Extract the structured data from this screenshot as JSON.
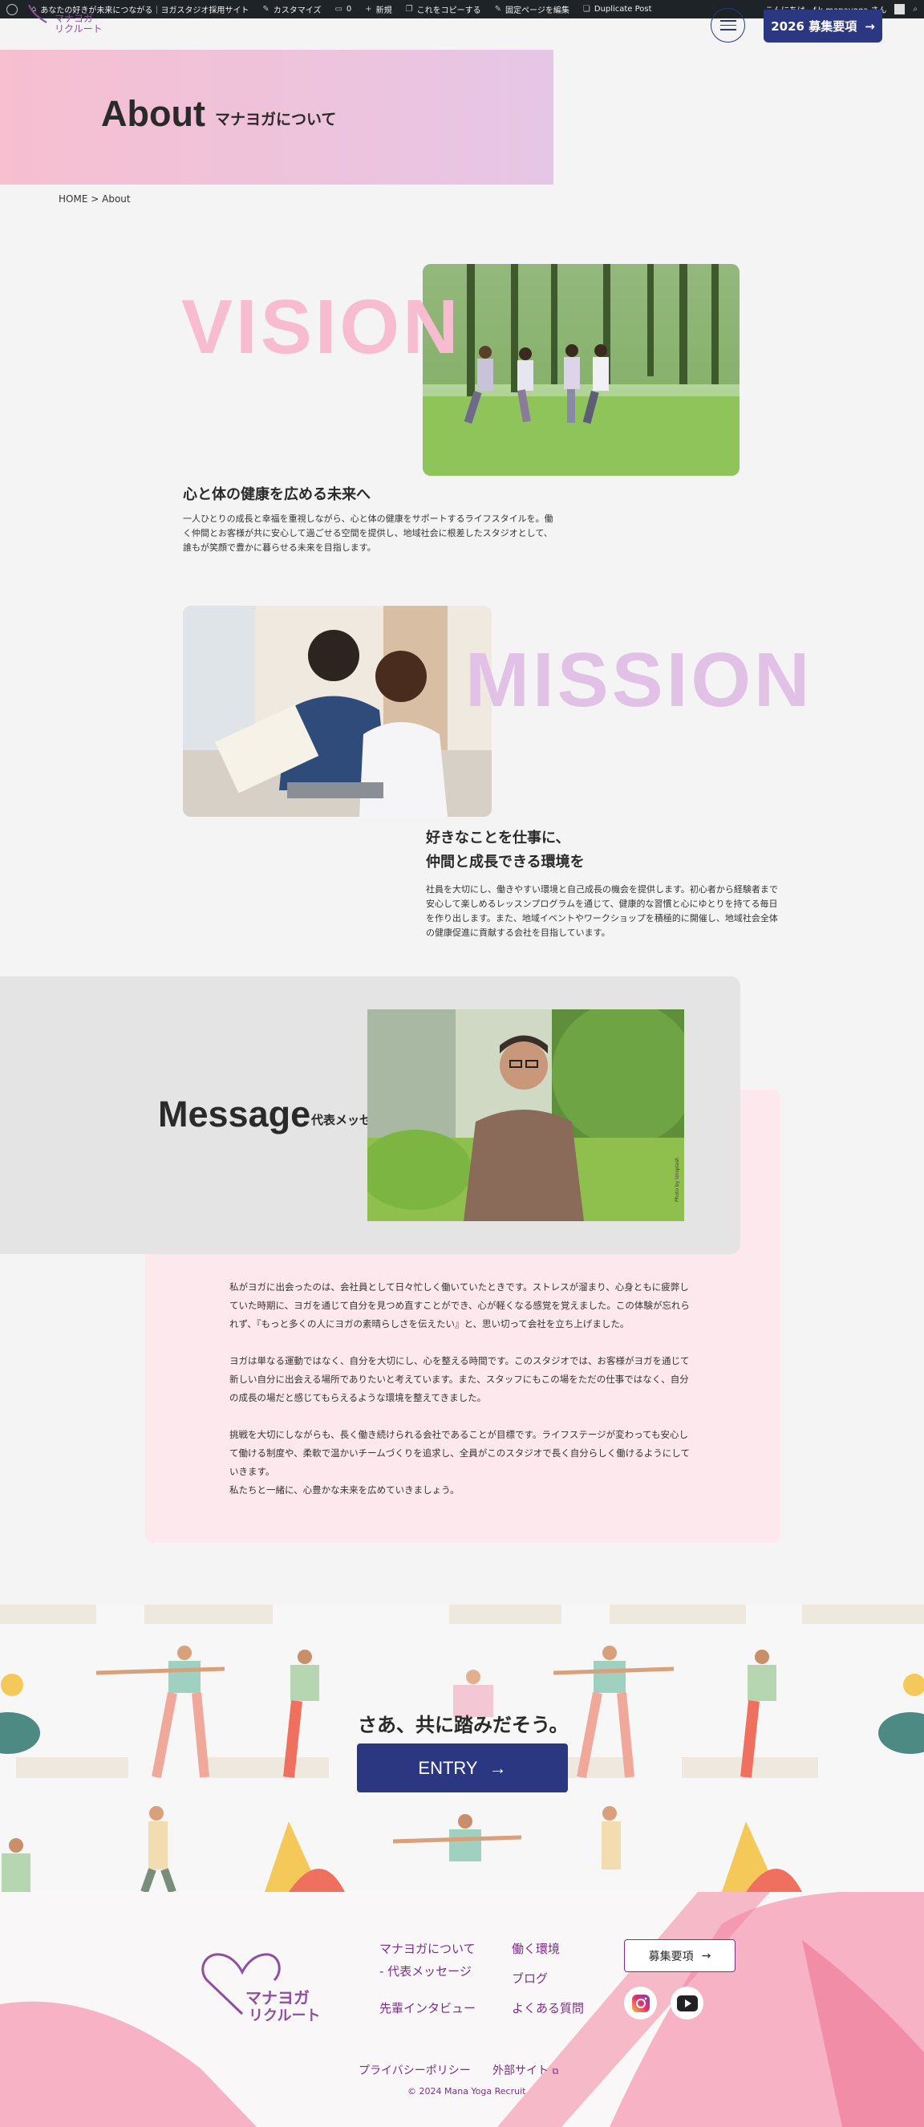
{
  "admin_bar": {
    "site_name": "あなたの好きが未来につながる｜ヨガスタジオ採用サイト",
    "customize": "カスタマイズ",
    "comments_count": "0",
    "new": "新規",
    "copy": "これをコピーする",
    "edit_fixed": "固定ページを編集",
    "duplicate": "Duplicate Post",
    "greeting": "こんにちは、f.k-manayoga さん"
  },
  "header": {
    "logo_line1": "マナヨガ",
    "logo_line2": "リクルート",
    "recruit_button": "2026 募集要項",
    "arrow": "→"
  },
  "hero": {
    "title": "About",
    "subtitle": "マナヨガについて"
  },
  "breadcrumb": {
    "home": "HOME",
    "separator": ">",
    "current": "About"
  },
  "vision": {
    "word": "VISION",
    "heading": "心と体の健康を広める未来へ",
    "text": "一人ひとりの成長と幸福を重視しながら、心と体の健康をサポートするライフスタイルを。働く仲間とお客様が共に安心して過ごせる空間を提供し、地域社会に根差したスタジオとして、誰もが笑顔で豊かに暮らせる未来を目指します。"
  },
  "mission": {
    "word": "MISSION",
    "heading_line1": "好きなことを仕事に、",
    "heading_line2": "仲間と成長できる環境を",
    "text": "社員を大切にし、働きやすい環境と自己成長の機会を提供します。初心者から経験者まで安心して楽しめるレッスンプログラムを通じて、健康的な習慣と心にゆとりを持てる毎日を作り出します。また、地域イベントやワークショップを積極的に開催し、地域社会全体の健康促進に貢献する会社を目指しています。"
  },
  "message": {
    "title": "Message",
    "subtitle": "代表メッセージ",
    "paragraphs": [
      "私がヨガに出会ったのは、会社員として日々忙しく働いていたときです。ストレスが溜まり、心身ともに疲弊していた時期に、ヨガを通じて自分を見つめ直すことができ、心が軽くなる感覚を覚えました。この体験が忘れられず、『もっと多くの人にヨガの素晴らしさを伝えたい』と、思い切って会社を立ち上げました。",
      "ヨガは単なる運動ではなく、自分を大切にし、心を整える時間です。このスタジオでは、お客様がヨガを通じて新しい自分に出会える場所でありたいと考えています。また、スタッフにもこの場をただの仕事ではなく、自分の成長の場だと感じてもらえるような環境を整えてきました。",
      "挑戦を大切にしながらも、長く働き続けられる会社であることが目標です。ライフステージが変わっても安心して働ける制度や、柔軟で温かいチームづくりを追求し、全員がこのスタジオで長く自分らしく働けるようにしていきます。\n私たちと一緒に、心豊かな未来を広めていきましょう。"
    ],
    "photo_credit": "Photo by Unsplash"
  },
  "entry": {
    "heading": "さあ、共に踏みだそう。",
    "button": "ENTRY",
    "arrow": "→"
  },
  "footer": {
    "logo_line1": "マナヨガ",
    "logo_line2": "リクルート",
    "links_col1": [
      "マナヨガについて",
      "- 代表メッセージ",
      "先輩インタビュー"
    ],
    "links_col2": [
      "働く環境",
      "ブログ",
      "よくある質問"
    ],
    "recruit_button": "募集要項",
    "arrow": "→",
    "privacy": "プライバシーポリシー",
    "external": "外部サイト",
    "copyright": "© 2024 Mana Yoga Recruit"
  },
  "colors": {
    "navy": "#2b3780",
    "pink": "#f8bcd1",
    "lavender": "#e1c2e6",
    "purple": "#7b2f84"
  }
}
